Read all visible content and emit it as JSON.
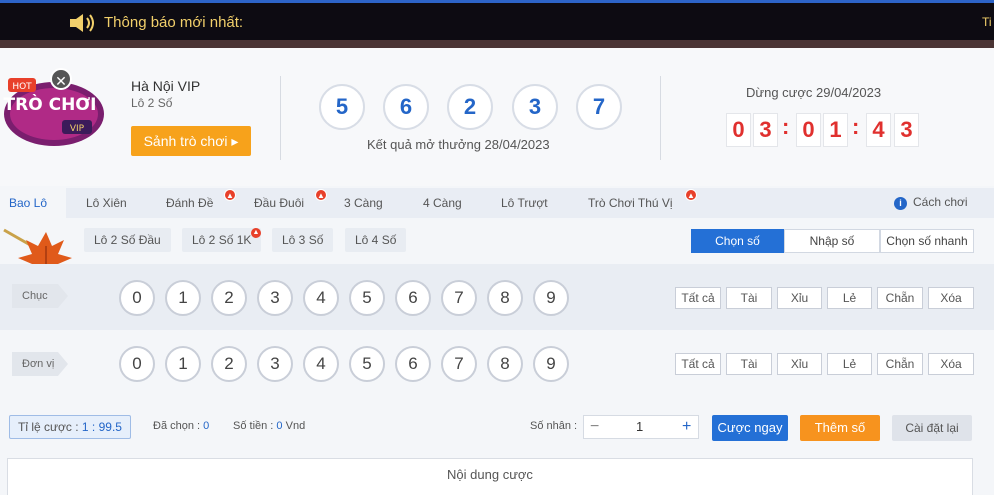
{
  "notice": {
    "title": "Thông báo mới nhất:",
    "tail": "Ti"
  },
  "game": {
    "name": "Hà Nội VIP",
    "subtitle": "Lô 2 Số",
    "lobby_button": "Sảnh trò chơi ▸",
    "logo_text_hot": "HOT",
    "logo_text_main": "TRÒ CHƠI",
    "logo_text_vip": "VIP",
    "close_glyph": "✕"
  },
  "result": {
    "balls": [
      "5",
      "6",
      "2",
      "3",
      "7"
    ],
    "label": "Kết quả mở thưởng 28/04/2023"
  },
  "countdown": {
    "label": "Dừng cược 29/04/2023",
    "digits": [
      "0",
      "3",
      "0",
      "1",
      "4",
      "3"
    ],
    "separator": ":"
  },
  "tabs": [
    {
      "label": "Bao Lô",
      "active": true
    },
    {
      "label": "Lô Xiên"
    },
    {
      "label": "Đánh Đề",
      "hot": true
    },
    {
      "label": "Đầu Đuôi",
      "hot": true
    },
    {
      "label": "3 Càng"
    },
    {
      "label": "4 Càng"
    },
    {
      "label": "Lô Trượt"
    },
    {
      "label": "Trò Chơi Thú Vị",
      "hot": true
    }
  ],
  "how_to_play": "Cách chơi",
  "subtabs": [
    "Lô 2 Số Đầu",
    "Lô 2 Số 1K",
    "Lô 3 Số",
    "Lô 4 Số"
  ],
  "input_modes": [
    "Chọn số",
    "Nhập số",
    "Chọn số nhanh"
  ],
  "rows": [
    {
      "label": "Chục",
      "numbers": [
        "0",
        "1",
        "2",
        "3",
        "4",
        "5",
        "6",
        "7",
        "8",
        "9"
      ]
    },
    {
      "label": "Đơn vị",
      "numbers": [
        "0",
        "1",
        "2",
        "3",
        "4",
        "5",
        "6",
        "7",
        "8",
        "9"
      ]
    }
  ],
  "quick_buttons": [
    "Tất cả",
    "Tài",
    "Xỉu",
    "Lẻ",
    "Chẵn",
    "Xóa"
  ],
  "footer": {
    "ratio_label": "Tỉ lệ cược :",
    "ratio_value": "1 : 99.5",
    "selected_label": "Đã chọn :",
    "selected_value": "0",
    "amount_label": "Số tiền :",
    "amount_value": "0",
    "amount_unit": "Vnd",
    "multiplier_label": "Số nhân :",
    "multiplier_value": "1",
    "bet_now": "Cược ngay",
    "add_number": "Thêm số",
    "reset": "Cài đặt lại"
  },
  "bet_content": "Nội dung cược",
  "colors": {
    "primary": "#2470d6",
    "accent": "#f7931e",
    "countdown": "#e0302e",
    "notice": "#f2d06b"
  }
}
